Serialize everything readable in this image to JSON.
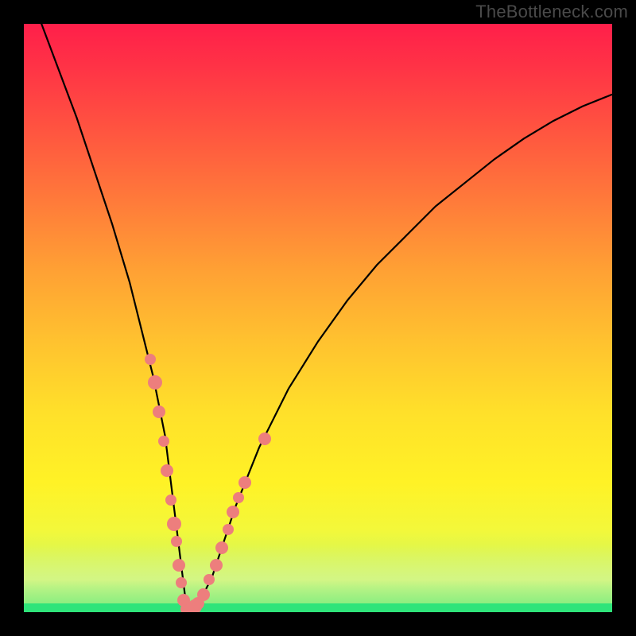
{
  "watermark": "TheBottleneck.com",
  "colors": {
    "frame_bg": "#000000",
    "dot_fill": "#ed7e7d",
    "curve_stroke": "#000000",
    "green_band": "#2fe47a",
    "pale_band": "#e6f7a2"
  },
  "chart_data": {
    "type": "line",
    "title": "",
    "xlabel": "",
    "ylabel": "",
    "xlim": [
      0,
      100
    ],
    "ylim": [
      0,
      100
    ],
    "grid": false,
    "legend": false,
    "annotations": [
      "TheBottleneck.com"
    ],
    "series": [
      {
        "name": "bottleneck-curve",
        "x": [
          0,
          3,
          6,
          9,
          12,
          15,
          18,
          20,
          22,
          24,
          25,
          26,
          27,
          27.5,
          28,
          28.5,
          30,
          32,
          34,
          36,
          40,
          45,
          50,
          55,
          60,
          65,
          70,
          75,
          80,
          85,
          90,
          95,
          100
        ],
        "y": [
          108,
          100,
          92,
          84,
          75,
          66,
          56,
          48,
          40,
          30,
          22,
          14,
          6,
          2,
          0.5,
          0.5,
          2,
          6,
          12,
          18,
          28,
          38,
          46,
          53,
          59,
          64,
          69,
          73,
          77,
          80.5,
          83.5,
          86,
          88
        ]
      }
    ],
    "dots": [
      {
        "x": 21.5,
        "y": 43,
        "r": 7
      },
      {
        "x": 22.3,
        "y": 39,
        "r": 9
      },
      {
        "x": 23.0,
        "y": 34,
        "r": 8
      },
      {
        "x": 23.8,
        "y": 29,
        "r": 7
      },
      {
        "x": 24.3,
        "y": 24,
        "r": 8
      },
      {
        "x": 25.0,
        "y": 19,
        "r": 7
      },
      {
        "x": 25.5,
        "y": 15,
        "r": 9
      },
      {
        "x": 25.9,
        "y": 12,
        "r": 7
      },
      {
        "x": 26.4,
        "y": 8,
        "r": 8
      },
      {
        "x": 26.8,
        "y": 5,
        "r": 7
      },
      {
        "x": 27.2,
        "y": 2,
        "r": 8
      },
      {
        "x": 27.7,
        "y": 0.6,
        "r": 8
      },
      {
        "x": 28.4,
        "y": 0.6,
        "r": 8
      },
      {
        "x": 29.0,
        "y": 1.0,
        "r": 9
      },
      {
        "x": 29.6,
        "y": 1.5,
        "r": 8
      },
      {
        "x": 30.5,
        "y": 3,
        "r": 8
      },
      {
        "x": 31.5,
        "y": 5.5,
        "r": 7
      },
      {
        "x": 32.7,
        "y": 8,
        "r": 8
      },
      {
        "x": 33.7,
        "y": 11,
        "r": 8
      },
      {
        "x": 34.7,
        "y": 14,
        "r": 7
      },
      {
        "x": 35.5,
        "y": 17,
        "r": 8
      },
      {
        "x": 36.5,
        "y": 19.5,
        "r": 7
      },
      {
        "x": 37.5,
        "y": 22,
        "r": 8
      },
      {
        "x": 41.0,
        "y": 29.5,
        "r": 8
      }
    ],
    "green_band_start": 0,
    "green_band_height": 1.5,
    "pale_band_start": 1.5,
    "pale_band_height": 10
  }
}
